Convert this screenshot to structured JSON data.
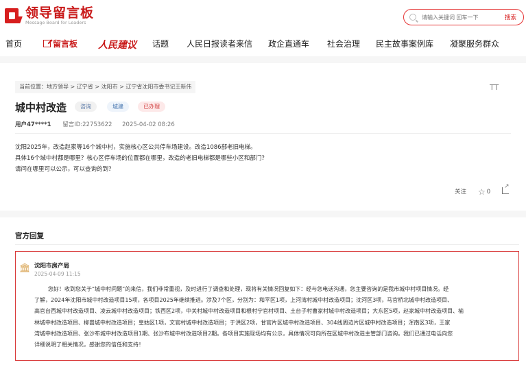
{
  "header": {
    "logo_cn": "领导留言板",
    "logo_en": "Message Board for Leaders",
    "search_placeholder": "请输入关键词 回车一下",
    "search_button": "搜索"
  },
  "nav": {
    "items": [
      "首页",
      "留言板",
      "人民建议",
      "话题",
      "人民日报读者来信",
      "政企直通车",
      "社会治理",
      "民主故事案例库",
      "凝聚服务群众"
    ]
  },
  "breadcrumb": "当前位置：地方领导 > 辽宁省 > 沈阳市 > 辽宁省沈阳市委书记王新伟",
  "font_icon_label": "TT",
  "message": {
    "title": "城中村改造",
    "tags": [
      "咨询",
      "城建",
      "已办理"
    ],
    "user": "用户47****1",
    "message_id": "留言ID:22753622",
    "datetime": "2025-04-02 08:26",
    "lines": [
      "沈阳2025年，改造赵家等16个城中村，实施核心区公共停车场建设。改造1086部老旧电梯。",
      "具体16个城中村都是哪里？核心区停车场的位置都在哪里，改造的老旧电梯都是哪些小区和部门？",
      "请问在哪里可以公示，可以查询的到？"
    ]
  },
  "actions": {
    "follow": "关注",
    "like_count": "0"
  },
  "reply": {
    "section_title": "官方回复",
    "org": "沈阳市房产局",
    "date": "2025-04-09 11:15",
    "lines": [
      "您好！收到您关于“城中村问题”的来信，我们非常重视，及时进行了调查和处理，现将有关情况回复如下：经与您电话沟通，您主要咨询的是我市城中村项目情况。经",
      "了解，2024年沈阳市城中村改造项目15项，各项目2025年继续推进。涉及7个区，分别为：和平区1项，上河湾村城中村改造项目；沈河区3项，马官桥北城中村改造项目、",
      "高官台西城中村改造项目、凌云城中村改造项目；铁西区2项，中关村城中村改造项目和根村宁官村项目、土台子村曹家村城中村改造项目；大东区5项，赵家城中村改造项目、榆",
      "林城中村改造项目、柳崮城中村改造项目；皇姑区1项，文官村城中村改造项目；于洪区2项，甘官片区城中村改造项目、304线周边片区城中村改造项目；浑南区3项，王家",
      "湾城中村改造项目、张沙布城中村改造项目1期、张沙布城中村改造项目2期。各项目实施现场均有公示，具体情况可向所在区城中村改造主管部门咨询。我们已通过电话向您",
      "详细说明了相关情况，感谢您的信任和支持！"
    ]
  }
}
